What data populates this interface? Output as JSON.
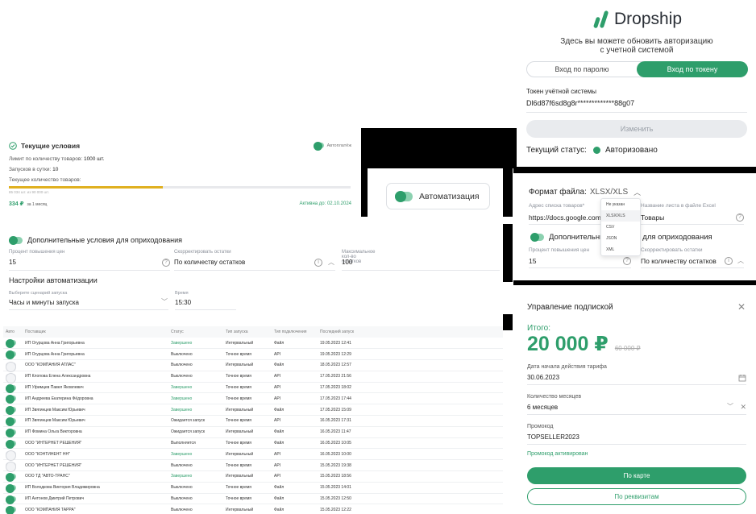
{
  "brand": {
    "name": "Dropship",
    "logo_color": "#2e9e6b"
  },
  "auth": {
    "description_line1": "Здесь вы можете обновить авторизацию",
    "description_line2": "с учетной системой",
    "tab_password": "Вход по паролю",
    "tab_token": "Вход по токену",
    "token_label": "Токен учётной системы",
    "token_value": "Dl6d87f6sd8g8r*************88g07",
    "change_button": "Изменить",
    "status_label": "Текущий статус:",
    "status_value": "Авторизовано"
  },
  "conditions": {
    "title": "Текущие условия",
    "autopay_label": "Автоплатёж",
    "limit_label": "Лимит по количеству товаров:",
    "limit_value": "1000 шт.",
    "launches_label": "Запусков в сутки:",
    "launches_value": "10",
    "current_label": "Текущее количество товаров:",
    "progress_caption": "85 034 шт. из 90 000 шт.",
    "progress_fraction": 0.45,
    "price": "334 ₽",
    "price_period": "за 1 месяц",
    "active_until": "Активна до: 02.10.2024"
  },
  "automation_chip": {
    "label": "Автоматизация"
  },
  "extra": {
    "title": "Дополнительные условия для оприходования",
    "price_increase_label": "Процент повышения цен",
    "price_increase_value": "15",
    "adjust_label": "Скорректировать остатки",
    "adjust_value": "По количеству остатков",
    "max_label": "Максимальное кол-во остатков",
    "max_value": "100"
  },
  "automation_settings": {
    "title": "Настройки автоматизации",
    "scenario_label": "Выберите сценарий запуска",
    "scenario_value": "Часы и минуты запуска",
    "time_label": "Время",
    "time_value": "15:30"
  },
  "table": {
    "headers": [
      "Авто",
      "Поставщик",
      "Статус",
      "Тип запуска",
      "Тип подключения",
      "Последний запуск"
    ],
    "rows": [
      {
        "auto": true,
        "supplier": "ИП Огурцова Анна Григорьевна",
        "status": "Завершено",
        "run": "Интервальный",
        "conn": "Файл",
        "last": "19.05.2023 12:41"
      },
      {
        "auto": true,
        "supplier": "ИП Огурцова Анна Григорьевна",
        "status": "Выключено",
        "run": "Точное время",
        "conn": "API",
        "last": "19.05.2023 12:29"
      },
      {
        "auto": false,
        "supplier": "ООО \"КОМПАНИЯ АТЛАС\"",
        "status": "Выключено",
        "run": "Интервальный",
        "conn": "Файл",
        "last": "18.05.2023 12:57"
      },
      {
        "auto": false,
        "supplier": "ИП Клопова Елена Александровна",
        "status": "Выключено",
        "run": "Точное время",
        "conn": "API",
        "last": "17.05.2023 21:56"
      },
      {
        "auto": true,
        "supplier": "ИП Уфимцев Павел Яковлевич",
        "status": "Завершено",
        "run": "Точное время",
        "conn": "API",
        "last": "17.05.2023 18:02"
      },
      {
        "auto": true,
        "supplier": "ИП Андреева Екатерина Фёдоровна",
        "status": "Завершено",
        "run": "Точное время",
        "conn": "API",
        "last": "17.05.2023 17:44"
      },
      {
        "auto": true,
        "supplier": "ИП Звягинцев Максим Юрьевич",
        "status": "Завершено",
        "run": "Интервальный",
        "conn": "Файл",
        "last": "17.05.2023 15:09"
      },
      {
        "auto": true,
        "supplier": "ИП Звягинцев Максим Юрьевич",
        "status": "Ожидается запуск",
        "run": "Точное время",
        "conn": "API",
        "last": "16.05.2023 17:31"
      },
      {
        "auto": true,
        "supplier": "ИП Фомина Ольга Викторовна",
        "status": "Ожидается запуск",
        "run": "Интервальный",
        "conn": "Файл",
        "last": "16.05.2023 11:47"
      },
      {
        "auto": true,
        "supplier": "ООО \"ИНТЕРНЕТ РЕШЕНИЯ\"",
        "status": "Выполняется",
        "run": "Точное время",
        "conn": "Файл",
        "last": "16.05.2023 10:05"
      },
      {
        "auto": false,
        "supplier": "ООО \"КОНТИНЕНТ НН\"",
        "status": "Завершено",
        "run": "Интервальный",
        "conn": "API",
        "last": "16.05.2023 10:00"
      },
      {
        "auto": false,
        "supplier": "ООО \"ИНТЕРНЕТ РЕШЕНИЯ\"",
        "status": "Выключено",
        "run": "Точное время",
        "conn": "API",
        "last": "15.05.2023 19:38"
      },
      {
        "auto": true,
        "supplier": "ООО ТД \"АВТО-ТРАНС\"",
        "status": "Завершено",
        "run": "Интервальный",
        "conn": "API",
        "last": "15.05.2023 18:56"
      },
      {
        "auto": true,
        "supplier": "ИП Володкова Виктория Владимировна",
        "status": "Выключено",
        "run": "Точное время",
        "conn": "Файл",
        "last": "15.05.2023 14:01"
      },
      {
        "auto": true,
        "supplier": "ИП Антонов Дмитрий Петрович",
        "status": "Выключено",
        "run": "Точное время",
        "conn": "Файл",
        "last": "15.05.2023 12:50"
      },
      {
        "auto": true,
        "supplier": "ООО \"КОМПАНИЯ ТАРРА\"",
        "status": "Выключено",
        "run": "Интервальный",
        "conn": "Файл",
        "last": "15.05.2023 12:22"
      }
    ]
  },
  "format": {
    "title": "Формат файла:",
    "value": "XLSX/XLS",
    "address_label": "Адрес списка товаров*",
    "address_value": "https://docs.google.com",
    "sheet_label": "Название листа в файле Excel",
    "sheet_value": "Товары",
    "options": [
      "Не указан",
      "XLSX/XLS",
      "CSV",
      "JSON",
      "XML"
    ],
    "extra_title": "Дополнительные условия для оприходования",
    "price_label": "Процент повышения цен",
    "price_value": "15",
    "adjust_label": "Скорректировать остатки",
    "adjust_value": "По количеству остатков"
  },
  "subscription": {
    "title": "Управление подпиской",
    "total_label": "Итого:",
    "total_value": "20 000 ₽",
    "old_value": "60 000 ₽",
    "start_label": "Дата начала действия тарифа",
    "start_value": "30.06.2023",
    "months_label": "Количество месяцев",
    "months_value": "6 месяцев",
    "promo_label": "Промокод",
    "promo_value": "TOPSELLER2023",
    "promo_status": "Промокод активирован",
    "pay_card": "По карте",
    "pay_requisites": "По реквизитам"
  },
  "colors": {
    "accent": "#2e9e6b",
    "accent_light": "#e8f5ef",
    "progress": "#e0b020",
    "disabled": "#e9ebee"
  }
}
